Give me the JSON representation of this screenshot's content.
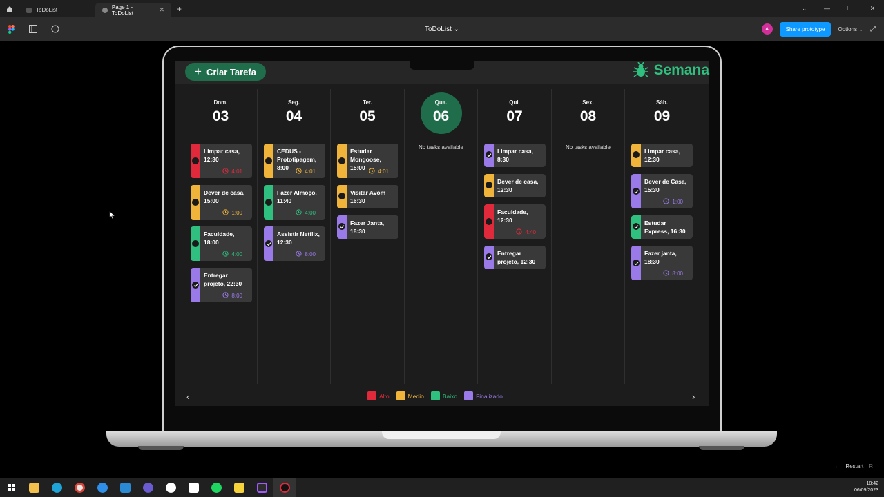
{
  "browser": {
    "tabs": [
      {
        "label": "ToDoList",
        "active": false
      },
      {
        "label": "Page 1 - ToDoList",
        "active": true
      }
    ]
  },
  "toolbar": {
    "file_title": "ToDoList",
    "avatar_initial": "A",
    "share_label": "Share prototype",
    "options_label": "Options"
  },
  "app": {
    "create_label": "Criar Tarefa",
    "brand": "Semana",
    "empty_label": "No tasks available",
    "colors": {
      "alto": "#e02a3c",
      "medio": "#f0b43b",
      "baixo": "#2fbf7e",
      "finalizado": "#9a7ae8",
      "accent": "#1f6d4b"
    },
    "days": [
      {
        "name": "Dom.",
        "date": "03",
        "today": false,
        "tasks": [
          {
            "title": "Limpar casa, 12:30",
            "priority": "alto",
            "duration": "4:01",
            "done": false
          },
          {
            "title": "Dever de casa, 15:00",
            "priority": "medio",
            "duration": "1:00",
            "done": false
          },
          {
            "title": "Faculdade, 18:00",
            "priority": "baixo",
            "duration": "4:00",
            "done": false
          },
          {
            "title": "Entregar projeto, 22:30",
            "priority": "finalizado",
            "duration": "8:00",
            "done": true
          }
        ]
      },
      {
        "name": "Seg.",
        "date": "04",
        "today": false,
        "tasks": [
          {
            "title": "CEDUS - Prototipagem, 8:00",
            "priority": "medio",
            "duration": "4:01",
            "done": false
          },
          {
            "title": "Fazer Almoço, 11:40",
            "priority": "baixo",
            "duration": "4:00",
            "done": false
          },
          {
            "title": "Assistir Netflix, 12:30",
            "priority": "finalizado",
            "duration": "8:00",
            "done": true
          }
        ]
      },
      {
        "name": "Ter.",
        "date": "05",
        "today": false,
        "tasks": [
          {
            "title": "Estudar Mongoose, 15:00",
            "priority": "medio",
            "duration": "4:01",
            "done": false
          },
          {
            "title": "Visitar Avóm 16:30",
            "priority": "medio",
            "duration": "",
            "done": false
          },
          {
            "title": "Fazer Janta, 18:30",
            "priority": "finalizado",
            "duration": "",
            "done": true
          }
        ]
      },
      {
        "name": "Qua.",
        "date": "06",
        "today": true,
        "tasks": []
      },
      {
        "name": "Qui.",
        "date": "07",
        "today": false,
        "tasks": [
          {
            "title": "Limpar casa, 8:30",
            "priority": "finalizado",
            "duration": "",
            "done": true
          },
          {
            "title": "Dever de casa, 12:30",
            "priority": "medio",
            "duration": "",
            "done": false
          },
          {
            "title": "Faculdade, 12:30",
            "priority": "alto",
            "duration": "4:40",
            "done": false
          },
          {
            "title": "Entregar projeto, 12:30",
            "priority": "finalizado",
            "duration": "",
            "done": true
          }
        ]
      },
      {
        "name": "Sex.",
        "date": "08",
        "today": false,
        "tasks": []
      },
      {
        "name": "Sáb.",
        "date": "09",
        "today": false,
        "tasks": [
          {
            "title": "Limpar casa, 12:30",
            "priority": "medio",
            "duration": "",
            "done": false
          },
          {
            "title": "Dever de Casa, 15:30",
            "priority": "finalizado",
            "duration": "1:00",
            "done": true
          },
          {
            "title": "Estudar Express, 16:30",
            "priority": "baixo",
            "duration": "",
            "done": true
          },
          {
            "title": "Fazer janta, 18:30",
            "priority": "finalizado",
            "duration": "8:00",
            "done": true
          }
        ]
      }
    ],
    "legend": [
      {
        "label": "Alto",
        "key": "alto"
      },
      {
        "label": "Medio",
        "key": "medio"
      },
      {
        "label": "Baixo",
        "key": "baixo"
      },
      {
        "label": "Finalizado",
        "key": "finalizado"
      }
    ]
  },
  "restart_label": "Restart",
  "clock": {
    "time": "18:42",
    "date": "06/09/2023"
  }
}
